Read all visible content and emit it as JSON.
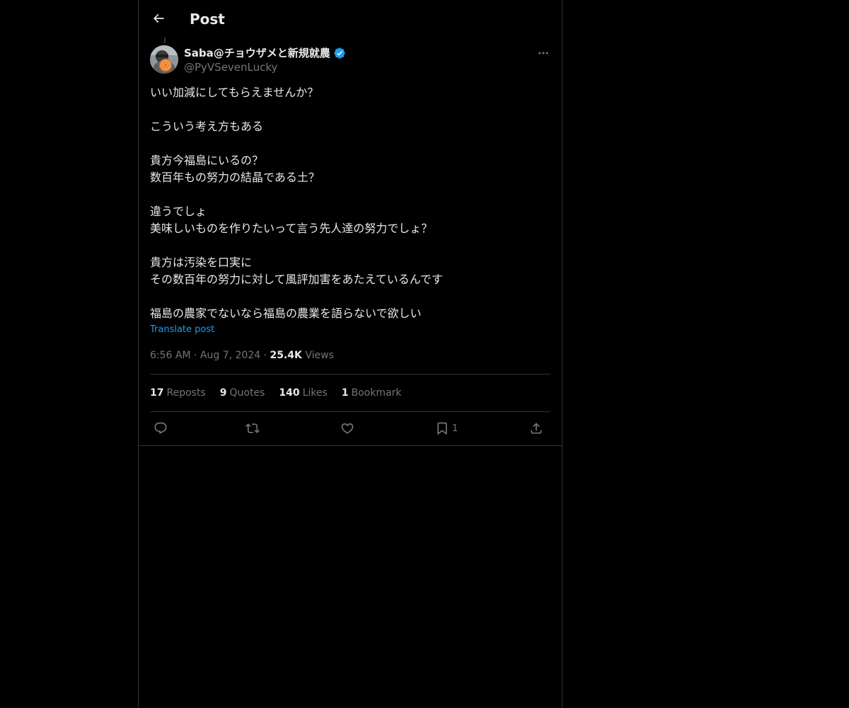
{
  "header": {
    "title": "Post",
    "back_icon": "arrow-left-icon"
  },
  "author": {
    "display_name": "Saba@チョウザメと新規就農",
    "handle": "@PyVSevenLucky",
    "verified": true,
    "verified_color": "#1d9bf0"
  },
  "tweet": {
    "lines": [
      "いい加減にしてもらえませんか？",
      "",
      "こういう考え方もある",
      "",
      "貴方今福島にいるの？",
      "数百年もの努力の結晶である土？",
      "",
      "違うでしょ",
      "美味しいものを作りたいって言う先人達の努力でしょ？",
      "",
      "貴方は汚染を口実に",
      "その数百年の努力に対して風評加害をあたえているんです",
      "",
      "福島の農家でないなら福島の農業を語らないで欲しい"
    ],
    "translate_label": "Translate post"
  },
  "meta": {
    "time": "6:56 AM",
    "separator": "·",
    "date": "Aug 7, 2024",
    "views_count": "25.4K",
    "views_label": "Views"
  },
  "stats": {
    "reposts_count": "17",
    "reposts_label": "Reposts",
    "quotes_count": "9",
    "quotes_label": "Quotes",
    "likes_count": "140",
    "likes_label": "Likes",
    "bookmarks_count": "1",
    "bookmarks_label": "Bookmark"
  },
  "actions": {
    "reply_icon": "reply-icon",
    "repost_icon": "repost-icon",
    "like_icon": "heart-icon",
    "bookmark_icon": "bookmark-icon",
    "bookmark_count": "1",
    "share_icon": "share-icon"
  },
  "colors": {
    "background": "#000000",
    "text": "#e7e9ea",
    "secondary": "#71767b",
    "accent": "#1d9bf0",
    "border": "#2f3336"
  }
}
